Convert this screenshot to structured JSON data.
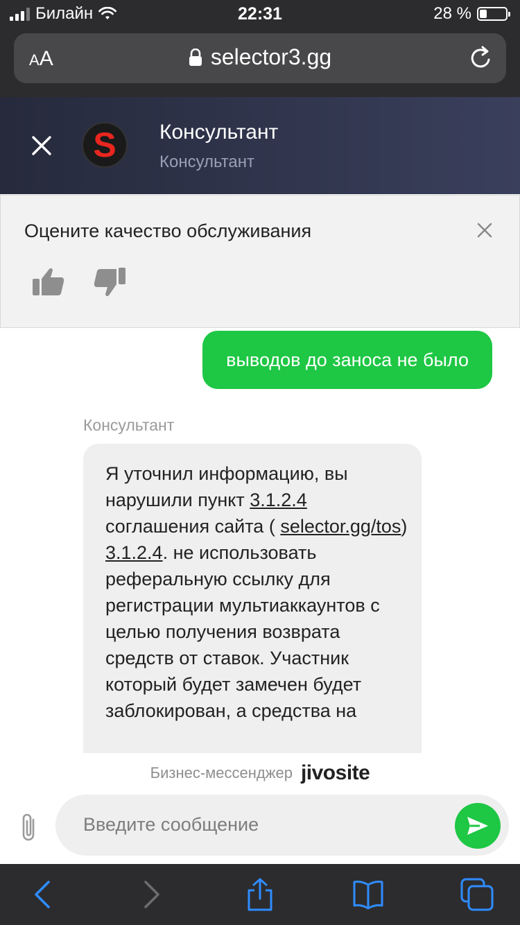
{
  "status_bar": {
    "carrier": "Билайн",
    "time": "22:31",
    "battery_percent": "28 %",
    "battery_level": 0.28
  },
  "browser": {
    "text_size_label_small": "A",
    "text_size_label_large": "A",
    "url": "selector3.gg",
    "lock_icon": "lock-icon",
    "reload_icon": "reload-icon"
  },
  "chat_header": {
    "avatar_letter": "S",
    "agent_name": "Консультант",
    "agent_role": "Консультант",
    "close_icon": "close-icon"
  },
  "rating": {
    "title": "Оцените качество обслуживания",
    "up_icon": "thumbs-up-icon",
    "down_icon": "thumbs-down-icon"
  },
  "messages": {
    "user_message": "выводов до заноса не было",
    "agent_label": "Консультант",
    "agent_message": {
      "p1": "Я уточнил информацию, вы нарушили пункт ",
      "link1": "3.1.2.4",
      "p2": " соглашения сайта ( ",
      "link2": "selector.gg/tos",
      "p3": ")",
      "link3": "3.1.2.4",
      "p4": ". не использовать реферальную ссылку для регистрации мультиаккаунтов с целью получения возврата средств от ставок. Участник который будет замечен будет заблокирован, а средства на"
    }
  },
  "branding": {
    "label": "Бизнес-мессенджер",
    "logo": "jivosite"
  },
  "input": {
    "placeholder": "Введите сообщение",
    "value": ""
  },
  "colors": {
    "accent_green": "#1ec744",
    "header_dark": "#262a3c",
    "ios_blue": "#2f8cff"
  }
}
